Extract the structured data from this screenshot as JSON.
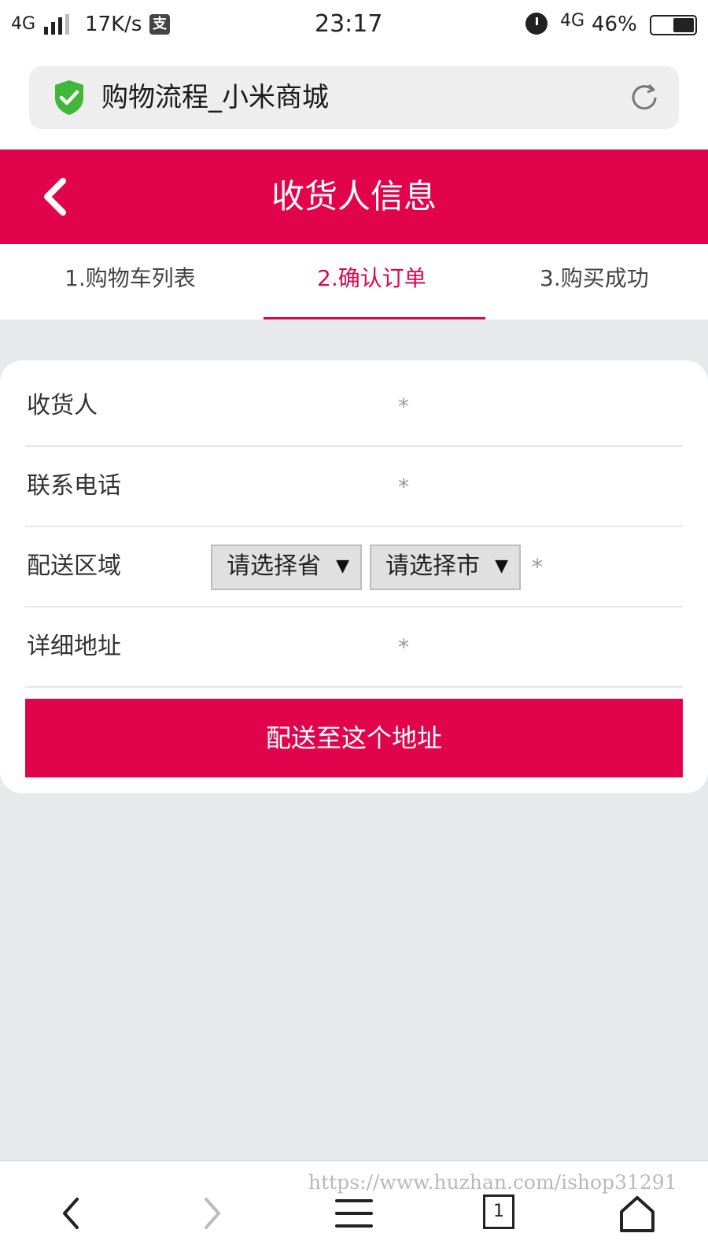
{
  "status_bar": {
    "network": "4G",
    "speed": "17K/s",
    "alipay_glyph": "支",
    "time": "23:17",
    "network2": "4G",
    "battery": "46%"
  },
  "browser": {
    "page_title": "购物流程_小米商城",
    "security_icon": "shield-check-icon",
    "reload_icon": "reload-icon"
  },
  "header": {
    "title": "收货人信息",
    "back_icon": "chevron-left-icon",
    "color": "#e1044d"
  },
  "steps": [
    {
      "label": "1.购物车列表",
      "active": false
    },
    {
      "label": "2.确认订单",
      "active": true
    },
    {
      "label": "3.购买成功",
      "active": false
    }
  ],
  "form": {
    "fields": [
      {
        "label": "收货人",
        "required_mark": "*"
      },
      {
        "label": "联系电话",
        "required_mark": "*"
      },
      {
        "label": "配送区域",
        "required_mark": "*"
      },
      {
        "label": "详细地址",
        "required_mark": "*"
      }
    ],
    "province_select": {
      "value": "请选择省",
      "arrow": "▼"
    },
    "city_select": {
      "value": "请选择市",
      "arrow": "▼"
    },
    "submit_label": "配送至这个地址"
  },
  "bottom_nav": {
    "watermark": "https://www.huzhan.com/ishop31291",
    "tab_count": "1",
    "icons": [
      "back-icon",
      "forward-icon",
      "menu-icon",
      "tabs-icon",
      "home-icon"
    ]
  }
}
